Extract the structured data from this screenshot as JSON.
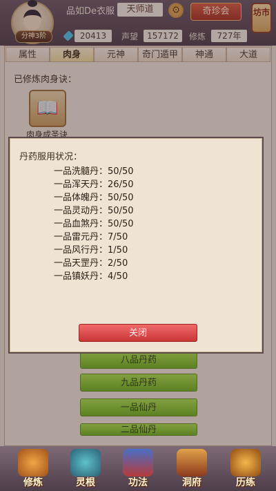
{
  "header": {
    "player_name": "品如De衣服",
    "title": "天师道",
    "treasure_button": "奇珍会",
    "market_button": "坊市",
    "rank_badge": "分神3阶",
    "gems": "20413",
    "reputation_label": "声望",
    "reputation_value": "157172",
    "cultivation_label": "修炼",
    "cultivation_value": "727年"
  },
  "tabs": [
    "属性",
    "肉身",
    "元神",
    "奇门遁甲",
    "神通",
    "大道"
  ],
  "active_tab": "肉身",
  "background": {
    "section_label": "已修炼肉身诀：",
    "book_caption": "肉身成圣诀",
    "items": [
      "八品丹药",
      "九品丹药",
      "一品仙丹",
      "二品仙丹"
    ]
  },
  "modal": {
    "title": "丹药服用状况：",
    "rows": [
      {
        "name": "一品洗髓丹",
        "value": "50/50"
      },
      {
        "name": "一品浑天丹",
        "value": "26/50"
      },
      {
        "name": "一品体魄丹",
        "value": "50/50"
      },
      {
        "name": "一品灵动丹",
        "value": "50/50"
      },
      {
        "name": "一品血煞丹",
        "value": "50/50"
      },
      {
        "name": "一品雷元丹",
        "value": "7/50"
      },
      {
        "name": "一品风行丹",
        "value": "1/50"
      },
      {
        "name": "一品天罡丹",
        "value": "2/50"
      },
      {
        "name": "一品镇妖丹",
        "value": "4/50"
      }
    ],
    "close_button": "关闭"
  },
  "bottom_nav": [
    {
      "label": "修炼",
      "icon": "cultivate-icon"
    },
    {
      "label": "灵根",
      "icon": "spirit-root-icon"
    },
    {
      "label": "功法",
      "icon": "technique-icon"
    },
    {
      "label": "洞府",
      "icon": "cave-icon"
    },
    {
      "label": "历练",
      "icon": "trial-icon"
    }
  ],
  "colors": {
    "accent_red": "#c93636",
    "accent_green": "#6fb21c",
    "header_bg": "#5a4855"
  }
}
